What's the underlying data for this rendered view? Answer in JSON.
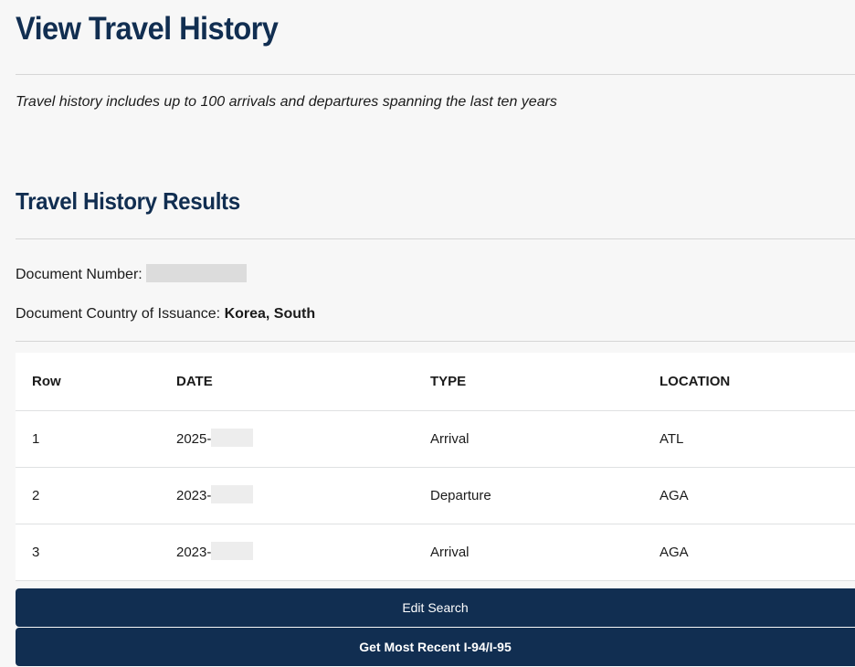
{
  "header": {
    "title": "View Travel History",
    "subtitle": "Travel history includes up to 100 arrivals and departures spanning the last ten years"
  },
  "results": {
    "title": "Travel History Results",
    "document_number_label": "Document Number:",
    "document_country_label": "Document Country of Issuance:",
    "document_country_value": "Korea, South"
  },
  "table": {
    "headers": {
      "row": "Row",
      "date": "DATE",
      "type": "TYPE",
      "location": "LOCATION"
    },
    "rows": [
      {
        "row": "1",
        "date": "2025-",
        "type": "Arrival",
        "location": "ATL"
      },
      {
        "row": "2",
        "date": "2023-",
        "type": "Departure",
        "location": "AGA"
      },
      {
        "row": "3",
        "date": "2023-",
        "type": "Arrival",
        "location": "AGA"
      }
    ]
  },
  "actions": {
    "edit_search": "Edit Search",
    "get_most_recent": "Get Most Recent I-94/I-95"
  },
  "colors": {
    "primary": "#112e51",
    "background": "#f7f7f7",
    "redaction": "#dcdcdc"
  }
}
